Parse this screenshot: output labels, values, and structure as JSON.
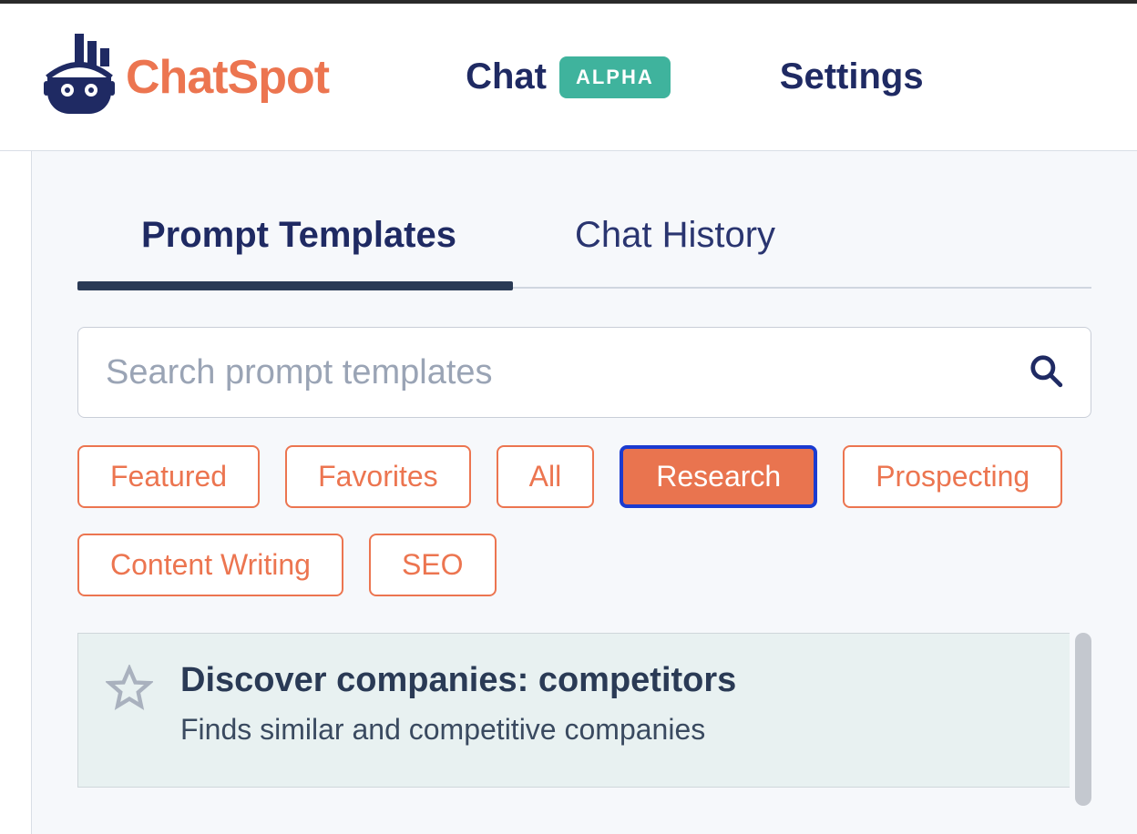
{
  "brand": {
    "name": "ChatSpot"
  },
  "nav": {
    "chat": "Chat",
    "alpha_badge": "ALPHA",
    "settings": "Settings"
  },
  "tabs": {
    "templates": "Prompt Templates",
    "history": "Chat History"
  },
  "search": {
    "placeholder": "Search prompt templates"
  },
  "filters": {
    "featured": "Featured",
    "favorites": "Favorites",
    "all": "All",
    "research": "Research",
    "prospecting": "Prospecting",
    "content_writing": "Content Writing",
    "seo": "SEO"
  },
  "card": {
    "title": "Discover companies: competitors",
    "description": "Finds similar and competitive companies"
  }
}
